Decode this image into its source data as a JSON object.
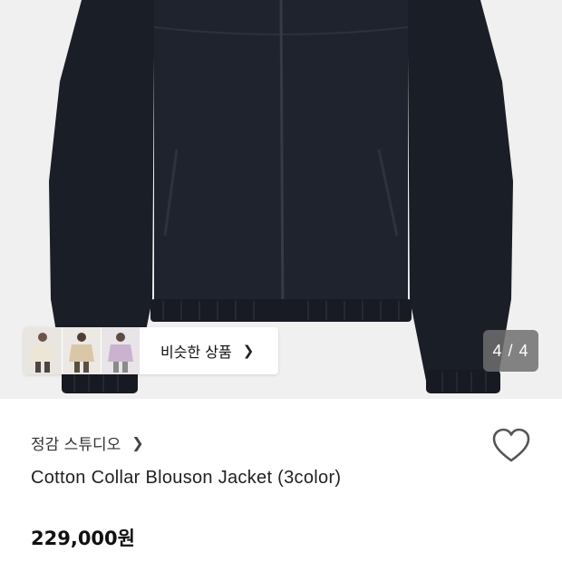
{
  "product_image": {
    "counter": "4 / 4",
    "similar_button_label": "비슷한 상품",
    "thumbnails": [
      "jacket-cream-model-thumb",
      "jacket-beige-model-thumb",
      "jacket-lilac-model-thumb"
    ]
  },
  "product": {
    "brand": "정감 스튜디오",
    "title": "Cotton Collar Blouson Jacket (3color)",
    "price": "229,000원"
  },
  "icons": {
    "brand_chevron": "chevron-right-icon",
    "similar_chevron": "chevron-right-icon",
    "wishlist": "heart-outline-icon"
  },
  "colors": {
    "jacket": "#1c2029",
    "hero_background": "#f0f0f0",
    "counter_background": "#6e6e6e"
  }
}
